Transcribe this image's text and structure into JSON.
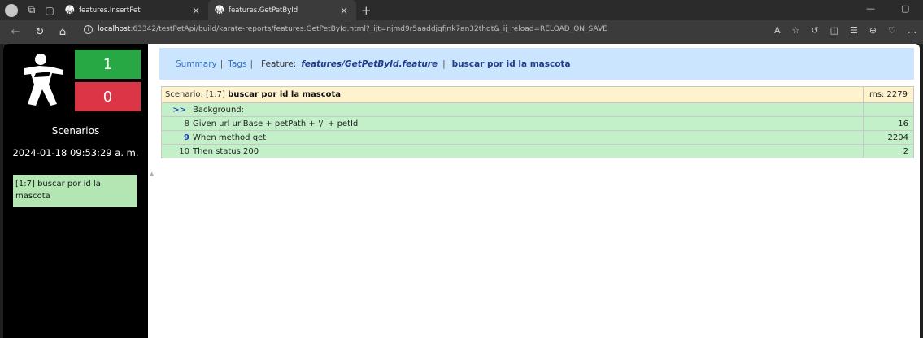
{
  "browser": {
    "tabs": [
      {
        "title": "features.InsertPet",
        "active": false
      },
      {
        "title": "features.GetPetById",
        "active": true
      }
    ],
    "new_tab": "+",
    "url_host": "localhost",
    "url_rest": ":63342/testPetApi/build/karate-reports/features.GetPetById.html?_ijt=njmd9r5aaddjqfjnk7an32thqt&_ij_reload=RELOAD_ON_SAVE"
  },
  "sidebar": {
    "passed": "1",
    "failed": "0",
    "scenarios_title": "Scenarios",
    "date": "2024-01-18 09:53:29 a. m.",
    "scenario_link": "[1:7] buscar por id la mascota"
  },
  "header": {
    "summary": "Summary",
    "tags": "Tags",
    "sep": "|",
    "feature_label": "Feature:",
    "feature_name": "features/GetPetById.feature",
    "scenario_name": "buscar por id la mascota"
  },
  "scenario": {
    "label": "Scenario: [1:7]",
    "name": "buscar por id la mascota",
    "ms": "ms: 2279"
  },
  "steps": [
    {
      "marker": ">>",
      "line": "",
      "text": "Background:",
      "duration": ""
    },
    {
      "marker": "",
      "line": "8",
      "text": "Given url urlBase + petPath + '/' + petId",
      "duration": "16"
    },
    {
      "marker": "",
      "line": "9",
      "text": "When method get",
      "duration": "2204"
    },
    {
      "marker": "",
      "line": "10",
      "text": "Then status 200",
      "duration": "2"
    }
  ],
  "colors": {
    "pass": "#28a745",
    "fail": "#dc3545",
    "header_bg": "#cce5ff",
    "scenario_bg": "#fff3cd",
    "step_bg": "#c3f0c8"
  }
}
